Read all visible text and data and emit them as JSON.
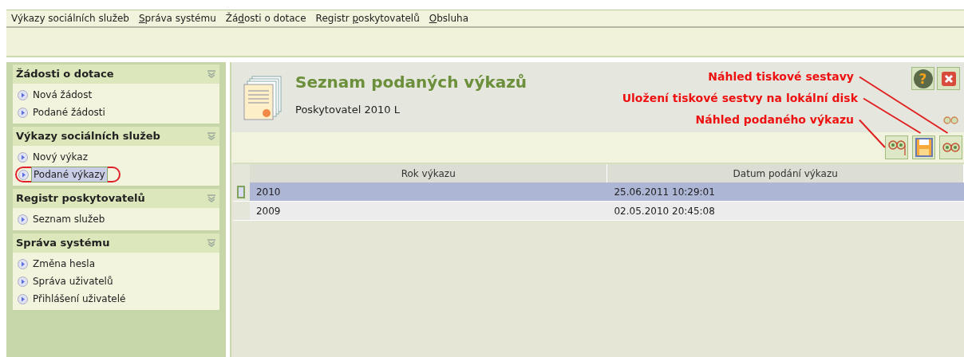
{
  "menu": [
    {
      "label": "Výkazy sociálních služeb"
    },
    {
      "accesskey": "S",
      "label_after": "práva systému"
    },
    {
      "label_before": "Žá",
      "accesskey": "d",
      "label_after": "osti o dotace"
    },
    {
      "label_before": "Registr ",
      "accesskey": "p",
      "label_after": "oskytovatelů"
    },
    {
      "accesskey": "O",
      "label_after": "bsluha"
    }
  ],
  "help_button": {
    "label": "?"
  },
  "sidebar": {
    "sections": [
      {
        "title": "Žádosti o dotace",
        "items": [
          {
            "label": "Nová žádost",
            "selected": false,
            "circled": false
          },
          {
            "label": "Podané žádosti",
            "selected": false,
            "circled": false
          }
        ]
      },
      {
        "title": "Výkazy sociálních služeb",
        "items": [
          {
            "label": "Nový výkaz",
            "selected": false,
            "circled": false
          },
          {
            "label": "Podané výkazy",
            "selected": true,
            "circled": true
          }
        ]
      },
      {
        "title": "Registr poskytovatelů",
        "items": [
          {
            "label": "Seznam služeb",
            "selected": false,
            "circled": false
          }
        ]
      },
      {
        "title": "Správa systému",
        "items": [
          {
            "label": "Změna hesla",
            "selected": false,
            "circled": false
          },
          {
            "label": "Správa uživatelů",
            "selected": false,
            "circled": false
          },
          {
            "label": "Přihlášení uživatelé",
            "selected": false,
            "circled": false
          }
        ]
      }
    ]
  },
  "page": {
    "title": "Seznam podaných výkazů",
    "subtitle": "Poskytovatel 2010 L"
  },
  "annotations": [
    {
      "text": "Náhled tiskové sestavy"
    },
    {
      "text": "Uložení tiskové sestvy na lokální disk"
    },
    {
      "text": "Náhled podaného výkazu"
    }
  ],
  "toolbar": [
    {
      "kind": "form-preview"
    },
    {
      "kind": "save"
    },
    {
      "kind": "report-preview"
    }
  ],
  "table": {
    "columns": [
      "Rok výkazu",
      "Datum podání výkazu"
    ],
    "rows": [
      {
        "cells": [
          "2010",
          "25.06.2011 10:29:01"
        ],
        "selected": true
      },
      {
        "cells": [
          "2009",
          "02.05.2010 20:45:08"
        ],
        "selected": false
      }
    ]
  }
}
